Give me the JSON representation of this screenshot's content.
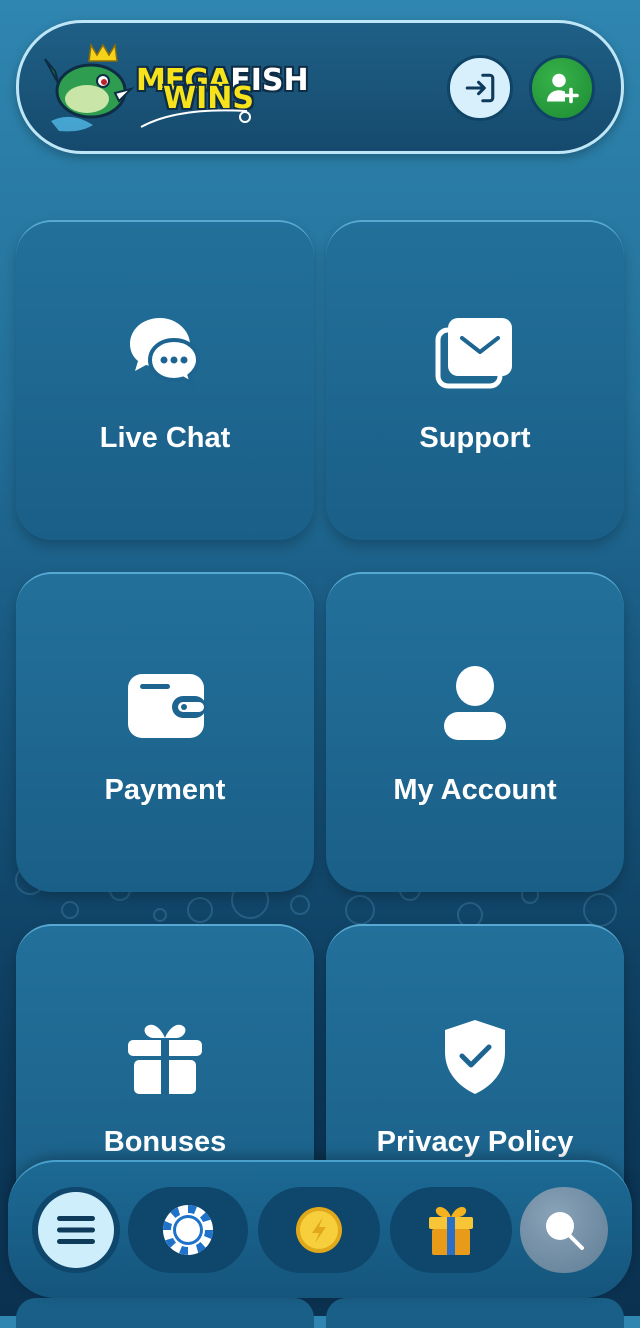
{
  "brand": {
    "line1_part1": "MEGA",
    "line1_part2": "FISH",
    "line2": "WINS"
  },
  "header": {
    "login_icon": "login-arrow-icon",
    "signup_icon": "add-user-icon"
  },
  "tiles": [
    {
      "label": "Live Chat",
      "icon": "chat-bubbles-icon"
    },
    {
      "label": "Support",
      "icon": "mail-icon"
    },
    {
      "label": "Payment",
      "icon": "wallet-icon"
    },
    {
      "label": "My Account",
      "icon": "user-icon"
    },
    {
      "label": "Bonuses",
      "icon": "gift-icon"
    },
    {
      "label": "Privacy Policy",
      "icon": "shield-check-icon"
    }
  ],
  "bottom_nav": {
    "items": [
      "menu-icon",
      "casino-chip-icon",
      "coin-icon",
      "gift-box-icon",
      "search-icon"
    ]
  },
  "colors": {
    "accent_green": "#1d8a33",
    "tile_blue": "#1a5f87",
    "logo_yellow": "#f6e31c"
  }
}
